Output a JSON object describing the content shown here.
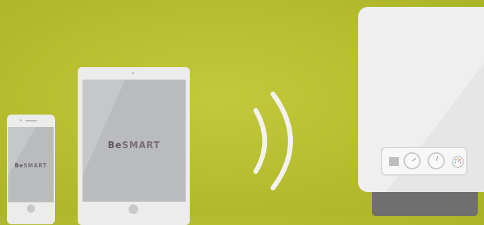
{
  "phone": {
    "logo_prefix": "Be",
    "logo_suffix": "SMART"
  },
  "tablet": {
    "logo_prefix": "Be",
    "logo_suffix": "SMART"
  },
  "colors": {
    "background": "#b8c02f",
    "device_body": "#ececec",
    "screen": "#b9bbbd",
    "logo": "#7a6f76",
    "boiler_body": "#efefef",
    "boiler_base": "#6f6f6f",
    "waves": "#f2f2f2"
  },
  "icons": [
    "wifi-signal-icon",
    "dial-knob-icon",
    "pressure-gauge-icon"
  ]
}
